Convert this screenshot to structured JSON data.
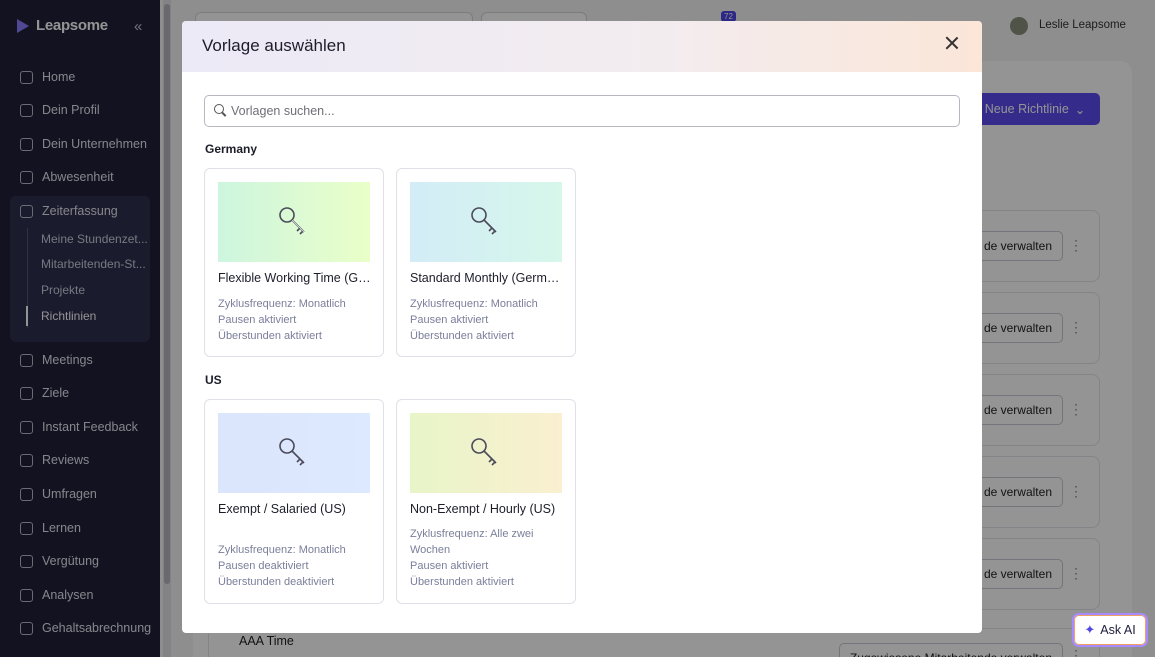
{
  "app": {
    "brand": "Leapsome",
    "collapse_glyph": "«"
  },
  "sidebar": {
    "items": [
      {
        "label": "Home",
        "icon": "home-icon"
      },
      {
        "label": "Dein Profil",
        "icon": "user-icon"
      },
      {
        "label": "Dein Unternehmen",
        "icon": "people-icon"
      },
      {
        "label": "Abwesenheit",
        "icon": "calendar-icon"
      },
      {
        "label": "Zeiterfassung",
        "icon": "clock-icon"
      },
      {
        "label": "Meetings",
        "icon": "calendar-icon"
      },
      {
        "label": "Ziele",
        "icon": "target-icon"
      },
      {
        "label": "Instant Feedback",
        "icon": "chat-icon"
      },
      {
        "label": "Reviews",
        "icon": "pencil-icon"
      },
      {
        "label": "Umfragen",
        "icon": "pulse-icon"
      },
      {
        "label": "Lernen",
        "icon": "book-icon"
      },
      {
        "label": "Vergütung",
        "icon": "money-icon"
      },
      {
        "label": "Analysen",
        "icon": "chart-icon"
      },
      {
        "label": "Gehaltsabrechnung",
        "icon": "payroll-icon"
      }
    ],
    "sub_items": [
      {
        "label": "Meine Stundenzet..."
      },
      {
        "label": "Mitarbeitenden-St..."
      },
      {
        "label": "Projekte"
      },
      {
        "label": "Richtlinien"
      }
    ]
  },
  "topbar": {
    "notification_count": "72",
    "user_name": "Leslie Leapsome"
  },
  "background": {
    "new_policy_label": "Neue Richtlinie",
    "row_button_label": "de verwalten",
    "row_button_full_label": "Zugewiesene Mitarbeitende verwalten",
    "last_row_name": "AAA Time"
  },
  "ask_ai": {
    "label": "Ask AI"
  },
  "modal": {
    "title": "Vorlage auswählen",
    "search_placeholder": "Vorlagen suchen...",
    "sections": [
      {
        "label": "Germany",
        "cards": [
          {
            "title": "Flexible Working Time (Ge...",
            "meta": [
              "Zyklusfrequenz: Monatlich",
              "Pausen aktiviert",
              "Überstunden aktiviert"
            ],
            "gradient": [
              "#cdf5df",
              "#eaffc8"
            ]
          },
          {
            "title": "Standard Monthly (Germa...",
            "meta": [
              "Zyklusfrequenz: Monatlich",
              "Pausen aktiviert",
              "Überstunden aktiviert"
            ],
            "gradient": [
              "#d3ecf7",
              "#d6f7ea"
            ]
          }
        ]
      },
      {
        "label": "US",
        "cards": [
          {
            "title": "Exempt / Salaried (US)",
            "meta": [
              "Zyklusfrequenz: Monatlich",
              "Pausen deaktiviert",
              "Überstunden deaktiviert"
            ],
            "gradient": [
              "#dbe5fb",
              "#dce9ff"
            ]
          },
          {
            "title": "Non-Exempt / Hourly (US)",
            "meta": [
              "Zyklusfrequenz: Alle zwei Wochen",
              "Pausen aktiviert",
              "Überstunden aktiviert"
            ],
            "gradient": [
              "#e8f5c8",
              "#faefd0"
            ]
          }
        ]
      }
    ]
  }
}
